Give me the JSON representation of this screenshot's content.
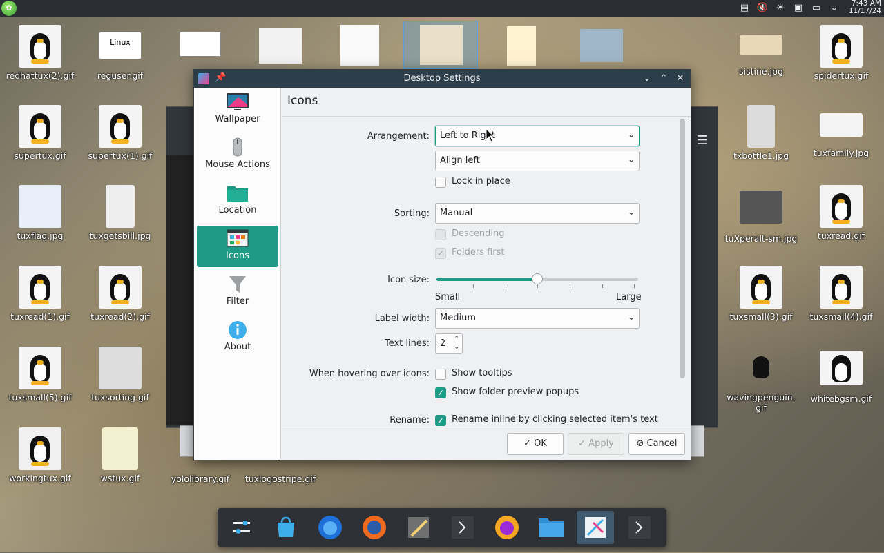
{
  "panel": {
    "time": "7:43 AM",
    "date": "11/17/24"
  },
  "desktop_icons": [
    {
      "label": "redhattux(2).gif"
    },
    {
      "label": "reguser.gif"
    },
    {
      "label": "sistine.jpg"
    },
    {
      "label": "spidertux.gif"
    },
    {
      "label": "supertux.gif"
    },
    {
      "label": "supertux(1).gif"
    },
    {
      "label": "txbottle1.jpg"
    },
    {
      "label": "tuxfamily.jpg"
    },
    {
      "label": "tuxflag.jpg"
    },
    {
      "label": "tuxgetsbill.jpg"
    },
    {
      "label": "tuXperalt-sm.jpg"
    },
    {
      "label": "tuxread.gif"
    },
    {
      "label": "tuxread(1).gif"
    },
    {
      "label": "tuxread(2).gif"
    },
    {
      "label": "tuxsmall(3).gif"
    },
    {
      "label": "tuxsmall(4).gif"
    },
    {
      "label": "tuxsmall(5).gif"
    },
    {
      "label": "tuxsorting.gif"
    },
    {
      "label": "wavingpenguin.\ngif"
    },
    {
      "label": "whitebgsm.gif"
    },
    {
      "label": "workingtux.gif"
    },
    {
      "label": "wstux.gif"
    },
    {
      "label": "yololibrary.gif"
    },
    {
      "label": "tuxlogostripe.gif"
    }
  ],
  "dialog": {
    "title": "Desktop Settings",
    "sidebar": [
      {
        "label": "Wallpaper",
        "icon": "monitor-icon"
      },
      {
        "label": "Mouse Actions",
        "icon": "mouse-icon"
      },
      {
        "label": "Location",
        "icon": "folder-icon"
      },
      {
        "label": "Icons",
        "icon": "icons-grid-icon",
        "active": true
      },
      {
        "label": "Filter",
        "icon": "filter-icon"
      },
      {
        "label": "About",
        "icon": "info-icon"
      }
    ],
    "page_title": "Icons",
    "arrangement": {
      "label": "Arrangement:",
      "value": "Left to Right"
    },
    "alignment": {
      "value": "Align left"
    },
    "lock_in_place": {
      "label": "Lock in place",
      "checked": false
    },
    "sorting": {
      "label": "Sorting:",
      "value": "Manual"
    },
    "descending": {
      "label": "Descending",
      "checked": false,
      "enabled": false
    },
    "folders_first": {
      "label": "Folders first",
      "checked": true,
      "enabled": false
    },
    "icon_size": {
      "label": "Icon size:",
      "min_label": "Small",
      "max_label": "Large",
      "level_fraction": 0.5
    },
    "label_width": {
      "label": "Label width:",
      "value": "Medium"
    },
    "text_lines": {
      "label": "Text lines:",
      "value": "2"
    },
    "hovering": {
      "label": "When hovering over icons:"
    },
    "show_tooltips": {
      "label": "Show tooltips",
      "checked": false
    },
    "show_folder_preview": {
      "label": "Show folder preview popups",
      "checked": true
    },
    "rename": {
      "label": "Rename:"
    },
    "rename_inline": {
      "label": "Rename inline by clicking selected item's text",
      "checked": true
    },
    "buttons": {
      "ok": "OK",
      "apply": "Apply",
      "cancel": "Cancel"
    }
  },
  "colors": {
    "accent": "#1e9a87",
    "titlebar": "#2b3e4a",
    "panel": "#2a2d31"
  }
}
